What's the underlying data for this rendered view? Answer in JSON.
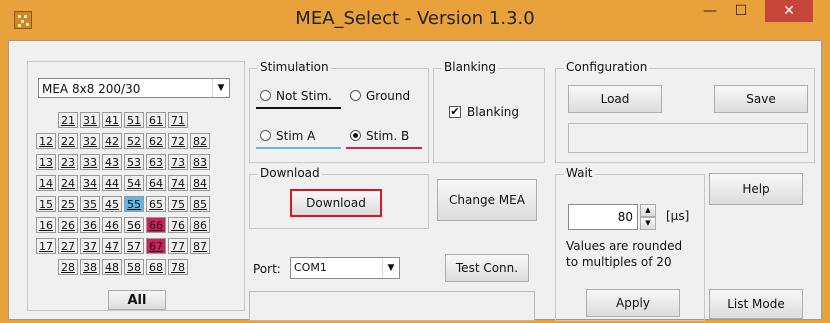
{
  "window": {
    "title": "MEA_Select  -  Version 1.3.0",
    "controls": {
      "minimize": "—",
      "maximize": "☐",
      "close": "✕"
    }
  },
  "mea_panel": {
    "mea_type": "MEA 8x8 200/30",
    "grid_rows": [
      [
        "21",
        "31",
        "41",
        "51",
        "61",
        "71"
      ],
      [
        "12",
        "22",
        "32",
        "42",
        "52",
        "62",
        "72",
        "82"
      ],
      [
        "13",
        "23",
        "33",
        "43",
        "53",
        "63",
        "73",
        "83"
      ],
      [
        "14",
        "24",
        "34",
        "44",
        "54",
        "64",
        "74",
        "84"
      ],
      [
        "15",
        "25",
        "35",
        "45",
        "55",
        "65",
        "75",
        "85"
      ],
      [
        "16",
        "26",
        "36",
        "46",
        "56",
        "66",
        "76",
        "86"
      ],
      [
        "17",
        "27",
        "37",
        "47",
        "57",
        "67",
        "77",
        "87"
      ],
      [
        "28",
        "38",
        "48",
        "58",
        "68",
        "78"
      ]
    ],
    "highlight_blue": [
      "55"
    ],
    "highlight_pink": [
      "66",
      "67"
    ],
    "all_button": "All"
  },
  "stimulation": {
    "label": "Stimulation",
    "not_stim": "Not Stim.",
    "ground": "Ground",
    "stim_a": "Stim A",
    "stim_b": "Stim. B",
    "selected": "Stim. B",
    "colors": {
      "not_stim": "#111111",
      "stim_a": "#5fb7ea",
      "stim_b": "#d1205f"
    }
  },
  "blanking": {
    "label": "Blanking",
    "checkbox_label": "Blanking",
    "checked": true
  },
  "configuration": {
    "label": "Configuration",
    "load": "Load",
    "save": "Save",
    "status": ""
  },
  "download": {
    "label": "Download",
    "button": "Download"
  },
  "change_mea": "Change MEA",
  "port": {
    "label": "Port:",
    "value": "COM1",
    "test_button": "Test Conn.",
    "status": ""
  },
  "wait": {
    "label": "Wait",
    "value": "80",
    "unit": "[µs]",
    "note_line1": "Values are rounded",
    "note_line2": "to multiples of 20",
    "apply": "Apply"
  },
  "help": "Help",
  "list_mode": "List Mode",
  "colors": {
    "frame": "#e9a23b",
    "close": "#c7463c",
    "highlight_border": "#e0141e"
  }
}
